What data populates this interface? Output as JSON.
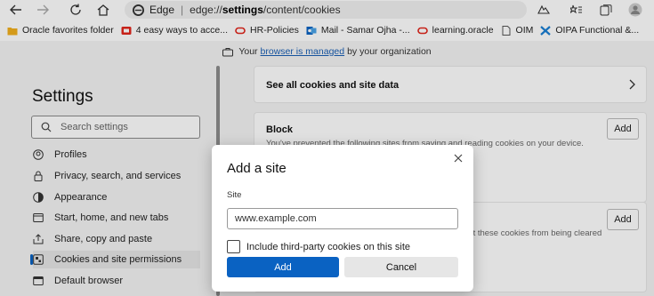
{
  "browser": {
    "brand": "Edge",
    "url_prefix": "edge://",
    "url_bold": "settings",
    "url_rest": "/content/cookies"
  },
  "favorites": [
    {
      "label": "Oracle favorites folder",
      "icon": "folder-icon",
      "color": "#f2b01e"
    },
    {
      "label": "4 easy ways to acce...",
      "icon": "youtube-icon",
      "color": "#e2261c"
    },
    {
      "label": "HR-Policies",
      "icon": "oracle-ring-icon",
      "color": "#e2261c"
    },
    {
      "label": "Mail - Samar Ojha -...",
      "icon": "outlook-icon",
      "color": "#0a62c2"
    },
    {
      "label": "learning.oracle",
      "icon": "oracle-ring-icon",
      "color": "#e2261c"
    },
    {
      "label": "OIM",
      "icon": "page-icon",
      "color": "#555555"
    },
    {
      "label": "OIPA Functional &...",
      "icon": "cross-icon",
      "color": "#1a7fd4"
    }
  ],
  "managed_banner": {
    "prefix": "Your",
    "link": "browser is managed",
    "suffix": "by your organization"
  },
  "settings": {
    "title": "Settings",
    "search_placeholder": "Search settings",
    "nav": [
      {
        "label": "Profiles",
        "icon": "profile-icon"
      },
      {
        "label": "Privacy, search, and services",
        "icon": "lock-icon"
      },
      {
        "label": "Appearance",
        "icon": "appearance-icon"
      },
      {
        "label": "Start, home, and new tabs",
        "icon": "home-tab-icon"
      },
      {
        "label": "Share, copy and paste",
        "icon": "share-icon"
      },
      {
        "label": "Cookies and site permissions",
        "icon": "cookies-icon",
        "active": true
      },
      {
        "label": "Default browser",
        "icon": "browser-icon"
      }
    ]
  },
  "cards": {
    "see_all": "See all cookies and site data",
    "block_title": "Block",
    "block_sub": "You've prevented the following sites from saving and reading cookies on your device.",
    "add_label": "Add",
    "clear_sub_fragment": "ent these cookies from being cleared"
  },
  "dialog": {
    "title": "Add a site",
    "site_label": "Site",
    "site_value": "www.example.com",
    "checkbox_label": "Include third-party cookies on this site",
    "add_button": "Add",
    "cancel_button": "Cancel"
  },
  "colors": {
    "accent": "#0a62c2"
  }
}
